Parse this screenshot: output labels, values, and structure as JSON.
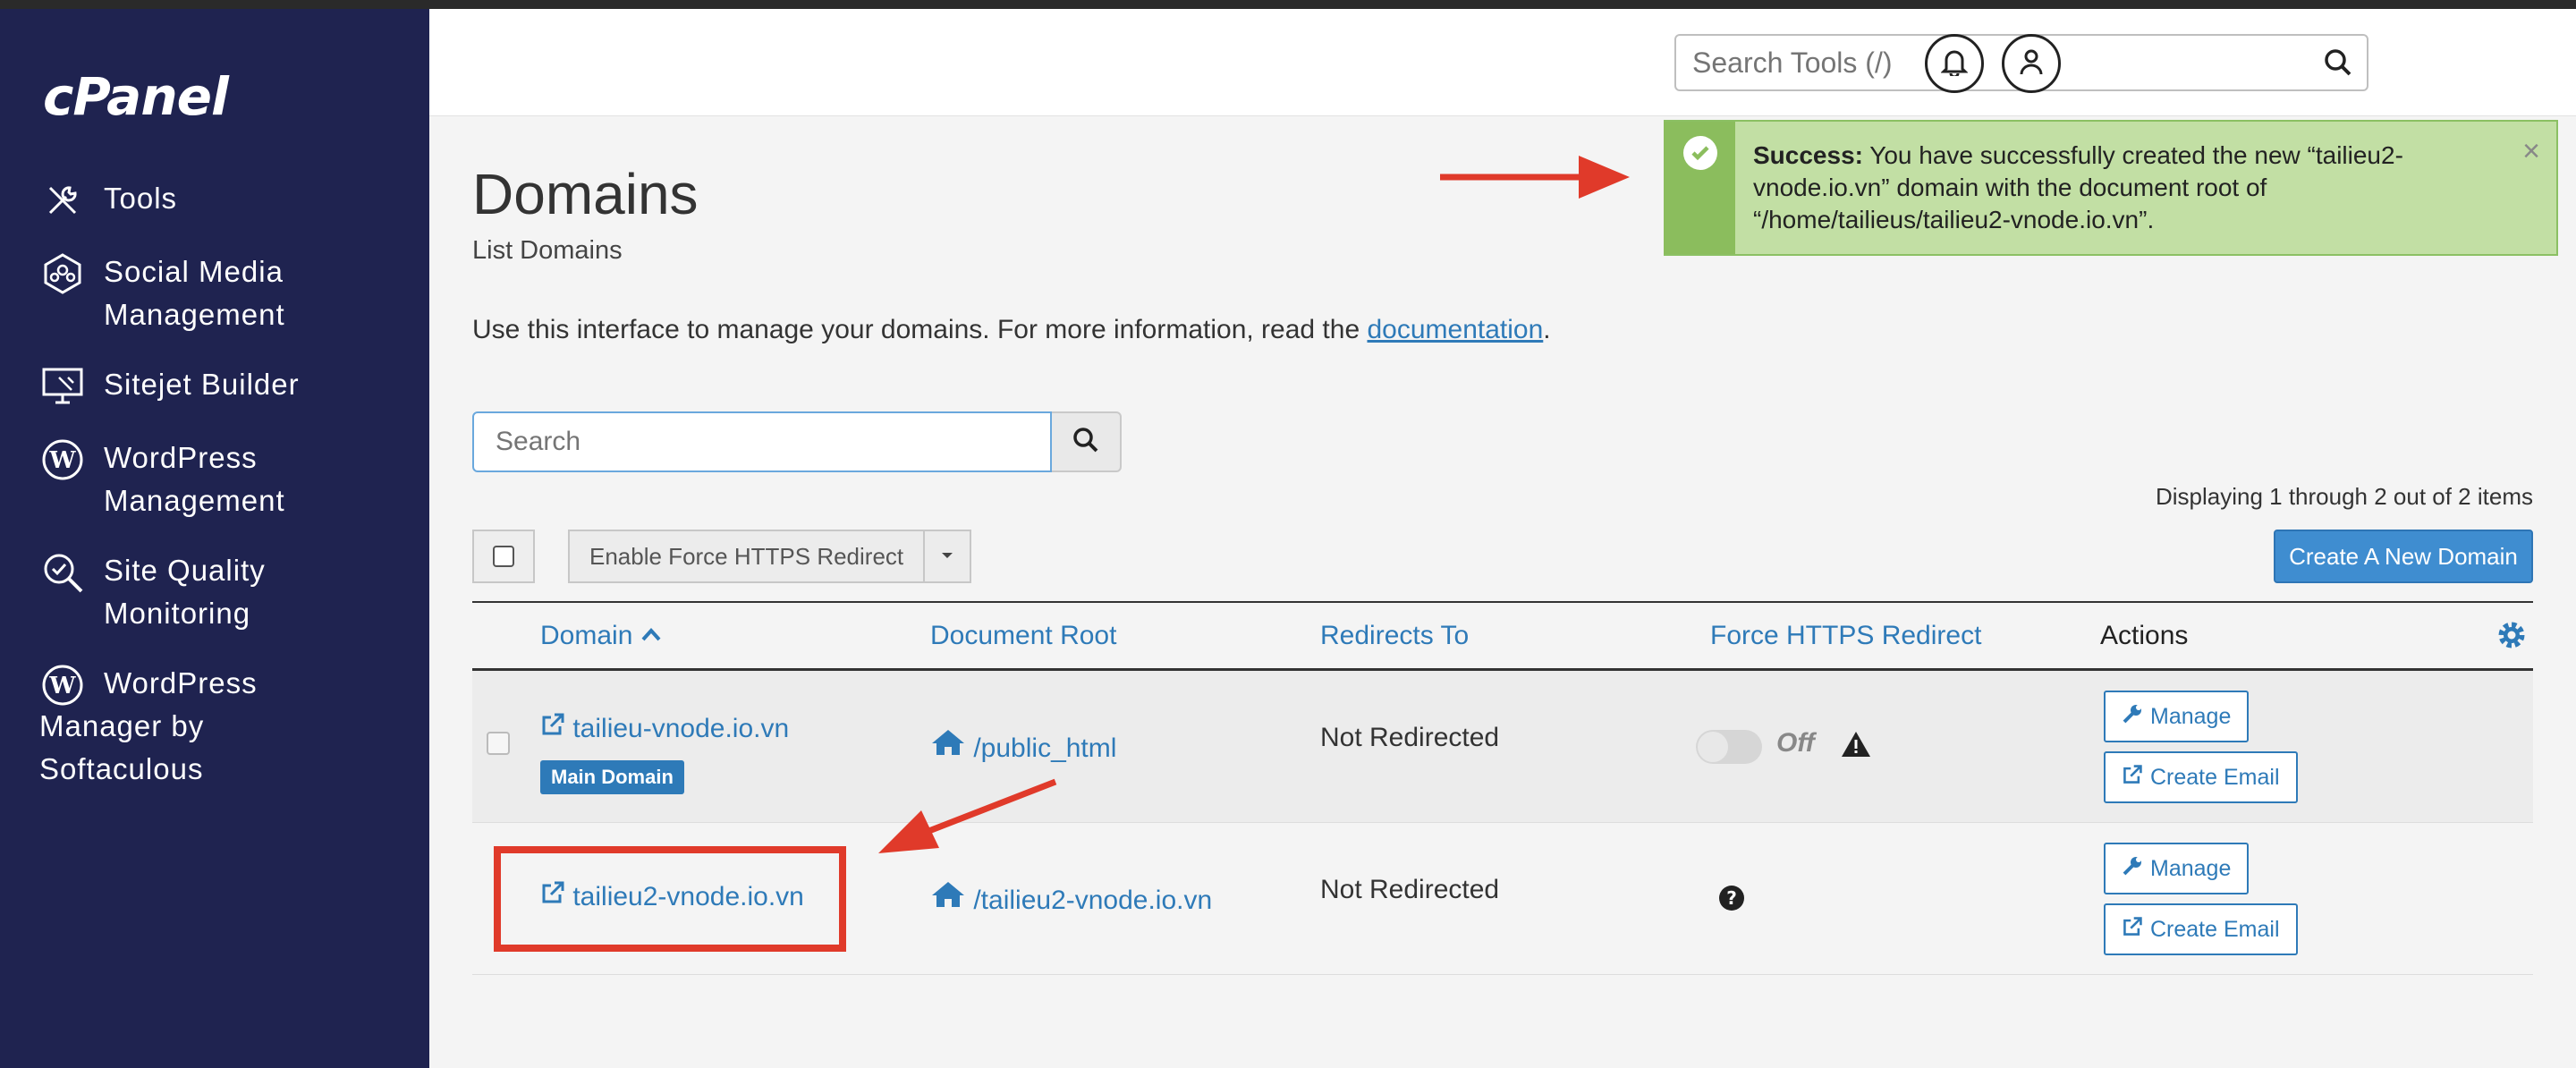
{
  "app": {
    "logo": "cPanel"
  },
  "colors": {
    "sidebar": "#1f2350",
    "accent": "#2e7ab8",
    "success": "#c2dfa4",
    "arrow": "#e03a2a"
  },
  "sidebar": {
    "items": [
      {
        "label": "Tools",
        "icon": "tools-icon"
      },
      {
        "label": "Social Media\nManagement",
        "icon": "social-media-icon"
      },
      {
        "label": "Sitejet Builder",
        "icon": "sitejet-icon"
      },
      {
        "label": "WordPress\nManagement",
        "icon": "wordpress-icon"
      },
      {
        "label": "Site Quality\nMonitoring",
        "icon": "site-quality-icon"
      },
      {
        "label": "WordPress\nManager by\nSoftaculous",
        "icon": "wordpress-softaculous-icon"
      }
    ]
  },
  "header": {
    "search_placeholder": "Search Tools (/)",
    "search_icon": "search-icon",
    "bell_icon": "bell-icon",
    "user_icon": "user-icon"
  },
  "alert": {
    "title": "Success:",
    "message": "You have successfully created the new “tailieu2-vnode.io.vn” domain with the document root of “/home/tailieus/tailieu2-vnode.io.vn”.",
    "close": "×"
  },
  "page": {
    "title": "Domains",
    "subtitle": "List Domains",
    "intro_text": "Use this interface to manage your domains. For more information, read the",
    "intro_link": "documentation",
    "intro_end": "."
  },
  "search": {
    "placeholder": "Search"
  },
  "toolbar": {
    "force_https_label": "Enable Force HTTPS Redirect",
    "create_label": "Create A New Domain",
    "displaying": "Displaying 1 through 2 out of 2 items"
  },
  "table": {
    "headers": {
      "domain": "Domain",
      "document_root": "Document Root",
      "redirects_to": "Redirects To",
      "force_https": "Force HTTPS Redirect",
      "actions": "Actions"
    },
    "rows": [
      {
        "domain": "tailieu-vnode.io.vn",
        "badge": "Main Domain",
        "document_root": "/public_html",
        "redirects_to": "Not Redirected",
        "force_https": "Off",
        "manage": "Manage",
        "create_email": "Create Email"
      },
      {
        "domain": "tailieu2-vnode.io.vn",
        "document_root": "/tailieu2-vnode.io.vn",
        "redirects_to": "Not Redirected",
        "manage": "Manage",
        "create_email": "Create Email"
      }
    ]
  }
}
